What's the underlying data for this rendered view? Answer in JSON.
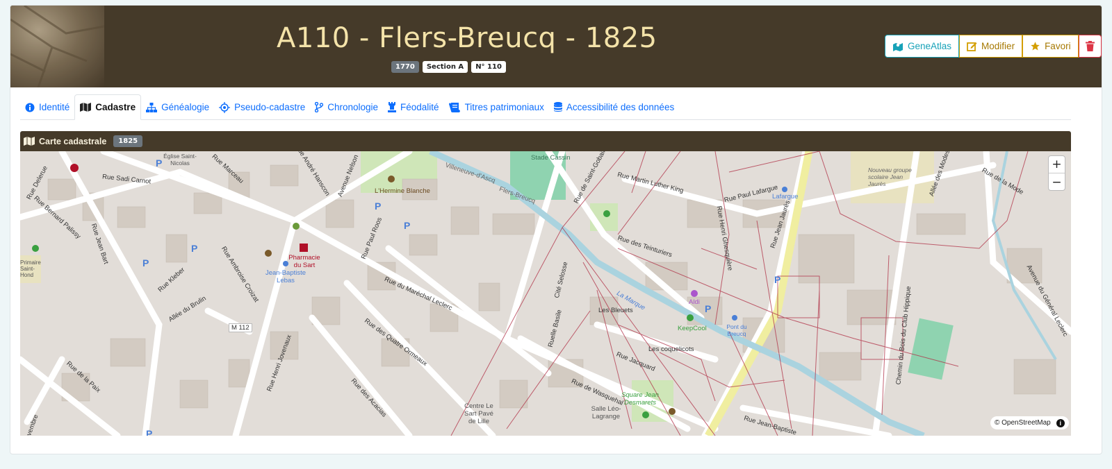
{
  "header": {
    "title": "A110 - Flers-Breucq - 1825",
    "badges": [
      "1770",
      "Section A",
      "N° 110"
    ],
    "actions": {
      "geneatlas": "GeneAtlas",
      "modifier": "Modifier",
      "favori": "Favori"
    }
  },
  "tabs": [
    {
      "label": "Identité",
      "icon": "info-circle-icon"
    },
    {
      "label": "Cadastre",
      "icon": "map-icon",
      "active": true
    },
    {
      "label": "Généalogie",
      "icon": "sitemap-icon"
    },
    {
      "label": "Pseudo-cadastre",
      "icon": "compass-icon"
    },
    {
      "label": "Chronologie",
      "icon": "branch-icon"
    },
    {
      "label": "Féodalité",
      "icon": "chess-rook-icon"
    },
    {
      "label": "Titres patrimoniaux",
      "icon": "scroll-icon"
    },
    {
      "label": "Accessibilité des données",
      "icon": "database-icon"
    }
  ],
  "panel": {
    "title": "Carte cadastrale",
    "badge": "1825"
  },
  "map": {
    "zoom_in": "+",
    "zoom_out": "−",
    "attribution": "© OpenStreetMap",
    "labels": {
      "sadi_carnot": "Rue Sadi Carnot",
      "marceau": "Rue Marceau",
      "andre_hanscon": "Rue André Hanscon",
      "avenue_nelson": "Avenue Nelson",
      "hermine": "L'Hermine Blanche",
      "stade": "Stade Cassin",
      "villeneuve": "Villeneuve-d'Ascq",
      "flers_breucq": "Flers-Breucq",
      "saint_gobain": "Rue de Saint-Gobain",
      "mlk": "Rue Martin Luther King",
      "paul_lafargue": "Rue Paul Lafargue",
      "lafargue": "Lafargue",
      "jean_jaures_rue": "Rue Jean Jaurès",
      "groupe_scolaire": "Nouveau groupe scolaire Jean Jaurès",
      "allee_modes": "Allée des Modes",
      "rue_mode": "Rue de la Mode",
      "bernard_palissy": "Rue Bernard Palissy",
      "delerue": "Rue Delerue",
      "jean_bart": "Rue Jean Bart",
      "kleber": "Rue Kleber",
      "ambroise_croizat": "Rue Ambroise Croizat",
      "pharmacie": "Pharmacie du Sart",
      "jb_lebas": "Jean-Baptiste Lebas",
      "paul_roos": "Rue Paul Roos",
      "marechal_leclerc": "Rue du Maréchal Leclerc",
      "teinturiers": "Rue des Teinturiers",
      "henri_ghesquiere": "Rue Henri Ghesquière",
      "cite_selosse": "Cité Selosse",
      "la_marque": "La Marque",
      "aldi": "Aldi",
      "keepcool": "KeepCool",
      "pont_breucq": "Pont du Breucq",
      "les_bleuets": "Les Bleuets",
      "coquelicots": "Les coquelicots",
      "jacquard": "Rue Jacquard",
      "wasquehal": "Rue de Wasquehal",
      "quatre_ormeaux": "Rue des Quatre Ormeaux",
      "acacias": "Rue des Acacias",
      "henri_jovenaux": "Rue Henri Jovenaux",
      "allee_brulin": "Allée du Brulin",
      "m112": "M 112",
      "rue_paix": "Rue de la Paix",
      "centre_sart": "Centre Le Sart Pavé de Lille",
      "salle_leo": "Salle Léo-Lagrange",
      "square_desmarets": "Square Jean Desmarets",
      "ruelle_basile": "Ruelle Basile",
      "chemin_bois": "Chemin du Bois du Club Hippique",
      "av_general": "Avenue du Général Leclerc",
      "jb_rue": "Rue Jean-Baptiste",
      "eglise": "Église Saint-Nicolas",
      "primaire": "Primaire Saint-Hond",
      "novembre": "Novembre"
    }
  }
}
